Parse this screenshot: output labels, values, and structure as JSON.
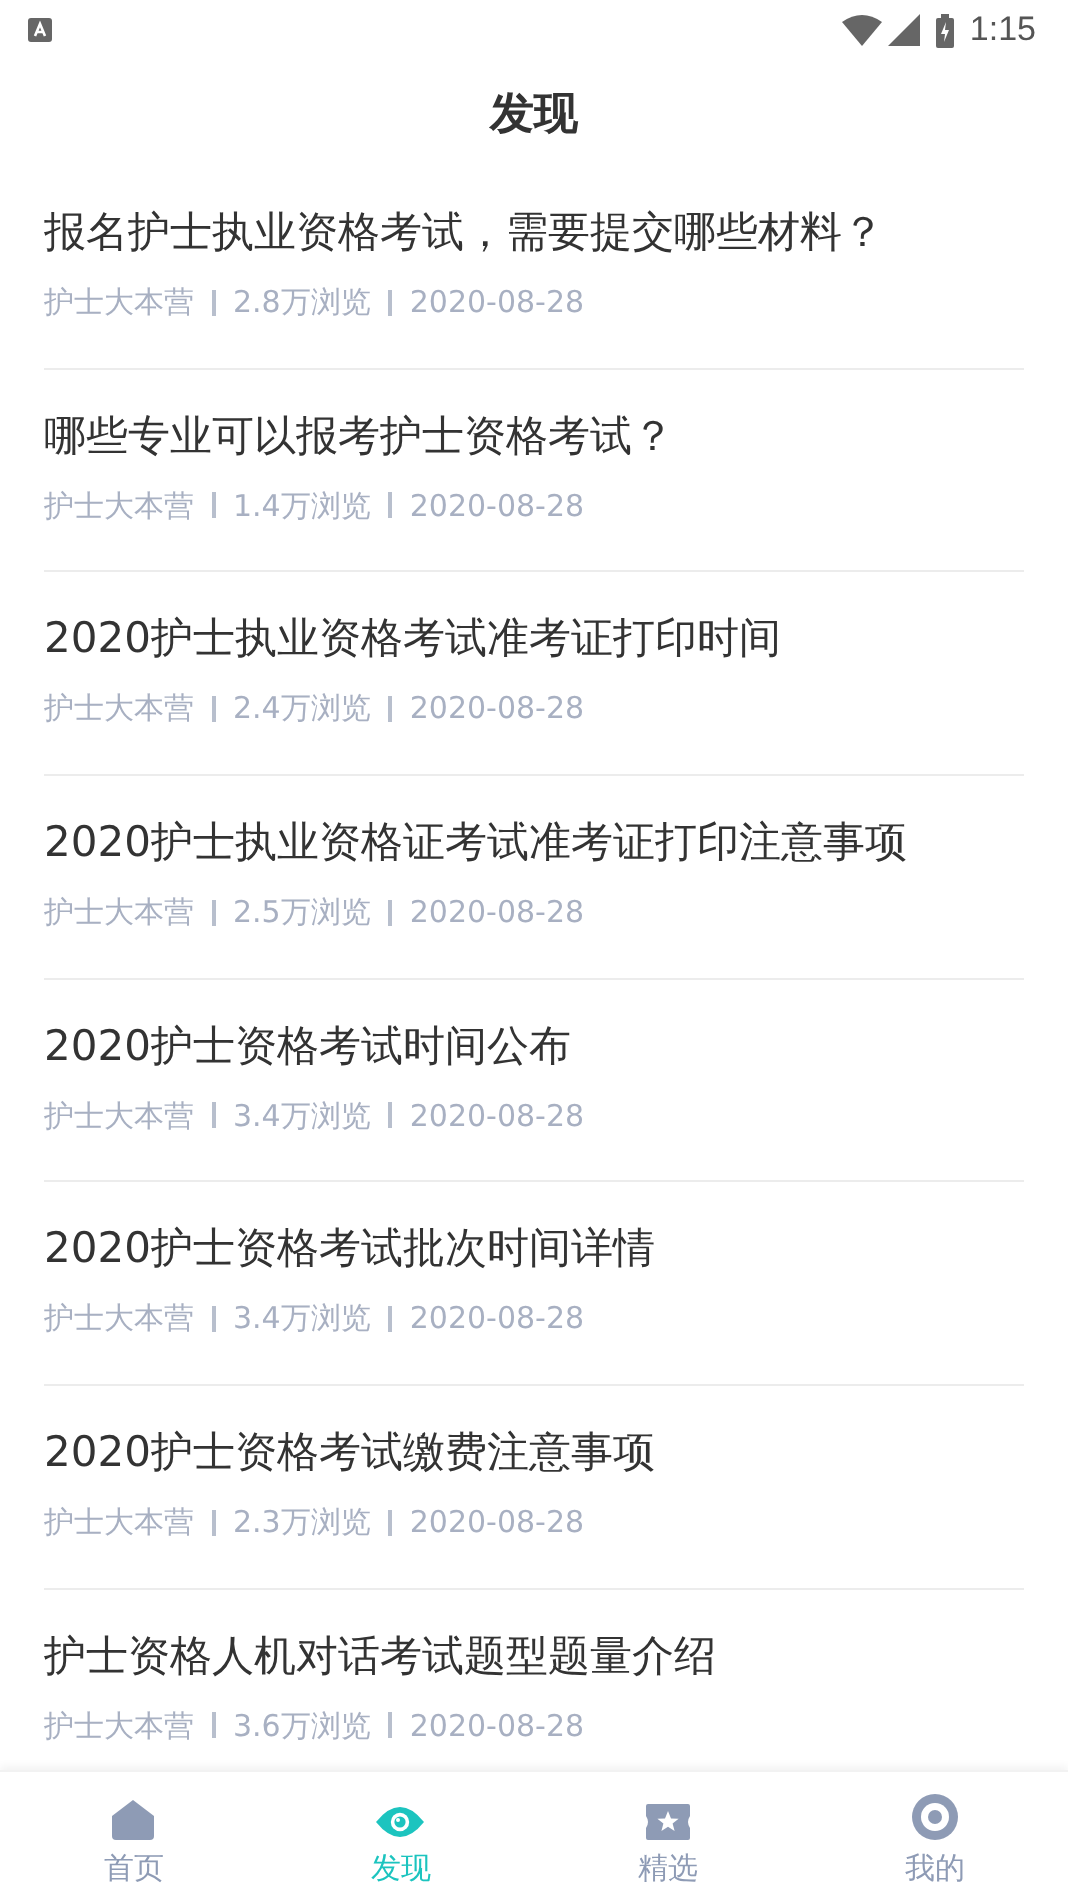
{
  "status_bar": {
    "time": "1:15"
  },
  "header": {
    "title": "发现"
  },
  "articles": [
    {
      "title": "报名护士执业资格考试，需要提交哪些材料？",
      "source": "护士大本营",
      "views": "2.8万浏览",
      "date": "2020-08-28"
    },
    {
      "title": "哪些专业可以报考护士资格考试？",
      "source": "护士大本营",
      "views": "1.4万浏览",
      "date": "2020-08-28"
    },
    {
      "title": "2020护士执业资格考试准考证打印时间",
      "source": "护士大本营",
      "views": "2.4万浏览",
      "date": "2020-08-28"
    },
    {
      "title": "2020护士执业资格证考试准考证打印注意事项",
      "source": "护士大本营",
      "views": "2.5万浏览",
      "date": "2020-08-28"
    },
    {
      "title": "2020护士资格考试时间公布",
      "source": "护士大本营",
      "views": "3.4万浏览",
      "date": "2020-08-28"
    },
    {
      "title": "2020护士资格考试批次时间详情",
      "source": "护士大本营",
      "views": "3.4万浏览",
      "date": "2020-08-28"
    },
    {
      "title": "2020护士资格考试缴费注意事项",
      "source": "护士大本营",
      "views": "2.3万浏览",
      "date": "2020-08-28"
    },
    {
      "title": "护士资格人机对话考试题型题量介绍",
      "source": "护士大本营",
      "views": "3.6万浏览",
      "date": "2020-08-28"
    }
  ],
  "tab_bar": [
    {
      "label": "首页",
      "kind": "home",
      "selected": false
    },
    {
      "label": "发现",
      "kind": "discover",
      "selected": true
    },
    {
      "label": "精选",
      "kind": "featured",
      "selected": false
    },
    {
      "label": "我的",
      "kind": "profile",
      "selected": false
    }
  ]
}
